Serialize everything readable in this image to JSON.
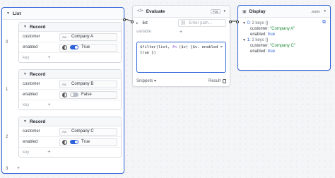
{
  "list_node": {
    "title": "List",
    "records": [
      {
        "index": "0",
        "title": "Record",
        "customer_key": "customer",
        "customer_type": "Aa",
        "customer_value": "Company A",
        "enabled_key": "enabled",
        "enabled_value": "True",
        "enabled_on": true,
        "key_placeholder": "key"
      },
      {
        "index": "1",
        "title": "Record",
        "customer_key": "customer",
        "customer_type": "Aa",
        "customer_value": "Company B",
        "enabled_key": "enabled",
        "enabled_value": "False",
        "enabled_on": false,
        "key_placeholder": "key"
      },
      {
        "index": "2",
        "title": "Record",
        "customer_key": "customer",
        "customer_type": "Aa",
        "customer_value": "Company C",
        "enabled_key": "enabled",
        "enabled_value": "True",
        "enabled_on": true,
        "key_placeholder": "key"
      }
    ],
    "footer_index": "3"
  },
  "evaluate_node": {
    "title": "Evaluate",
    "language_badge": "FQL",
    "var_name": "list",
    "var_placeholder": "Enter path...",
    "variable_label": "variable",
    "code_line1_a": "$filter(list, ",
    "code_line1_kw": "fn",
    "code_line1_b": " ($v) {$v. enabled =",
    "code_line2": "true })",
    "snippets_label": "Snippets",
    "result_label": "Result"
  },
  "display_node": {
    "title": "Display",
    "format_label": "JSON",
    "items": [
      {
        "index": "0:",
        "meta": "2 keys",
        "customer_key": "customer:",
        "customer_value": "\"Company A\"",
        "enabled_key": "enabled:",
        "enabled_value": "true"
      },
      {
        "index": "1:",
        "meta": "2 keys",
        "customer_key": "customer:",
        "customer_value": "\"Company C\"",
        "enabled_key": "enabled:",
        "enabled_value": "true"
      }
    ]
  },
  "icons": {
    "collapse": "chevron-down-icon",
    "code": "code-icon",
    "display": "display-icon",
    "link": "link-icon",
    "copy": "copy-icon",
    "add": "plus-icon"
  },
  "colors": {
    "accent": "#2f62d9",
    "string": "#1f8a3a",
    "keyword": "#7b3fc4"
  }
}
